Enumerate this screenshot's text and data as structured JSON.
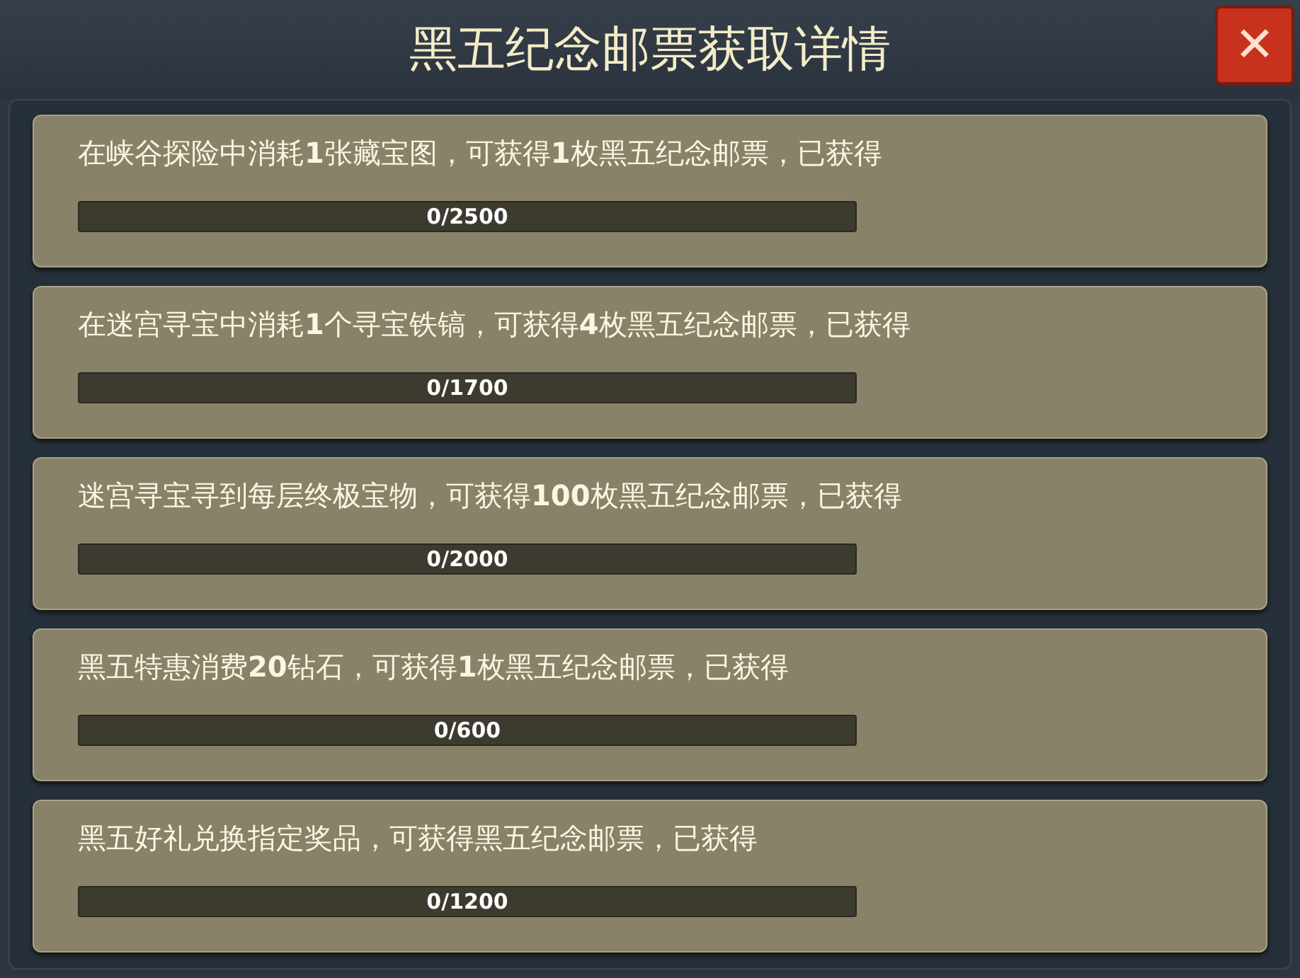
{
  "window": {
    "title": "黑五纪念邮票获取详情",
    "close": "✕"
  },
  "tasks": [
    {
      "text": "在峡谷探险中消耗**1**张藏宝图，可获得**1**枚黑五纪念邮票，已获得",
      "level": 0,
      "reading": "0/2500"
    },
    {
      "text": "在迷宫寻宝中消耗**1**个寻宝铁镐，可获得**4**枚黑五纪念邮票，已获得",
      "level": 0,
      "reading": "0/1700"
    },
    {
      "text": "迷宫寻宝寻到每层终极宝物，可获得**100**枚黑五纪念邮票，已获得",
      "level": 0,
      "reading": "0/2000"
    },
    {
      "text": "黑五特惠消费**20**钻石，可获得**1**枚黑五纪念邮票，已获得",
      "level": 0,
      "reading": "0/600"
    },
    {
      "text": "黑五好礼兑换指定奖品，可获得黑五纪念邮票，已获得",
      "level": 0,
      "reading": "0/1200"
    }
  ]
}
